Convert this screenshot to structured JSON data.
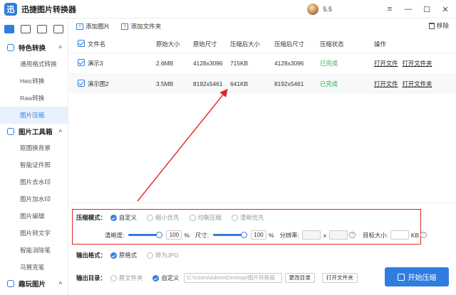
{
  "app": {
    "logo_glyph": "迅",
    "title": "迅捷图片转换器",
    "version": "5.5"
  },
  "window": {
    "menu_icon": "≡",
    "minimize_icon": "—",
    "maximize_icon": "☐",
    "close_icon": "✕"
  },
  "sidebar": {
    "sections": [
      {
        "title": "特色转换",
        "items": [
          "通用格式转换",
          "Heic转换",
          "Raw转换",
          "图片压缩"
        ]
      },
      {
        "title": "图片工具箱",
        "items": [
          "抠图换背景",
          "智能证件照",
          "图片去水印",
          "图片加水印",
          "图片编辑",
          "图片转文字",
          "智能消除笔",
          "马赛克笔"
        ]
      },
      {
        "title": "趣玩图片",
        "items": []
      }
    ],
    "active_item": "图片压缩"
  },
  "toolbar": {
    "add_image": "添加图片",
    "add_folder": "添加文件夹",
    "remove": "移除"
  },
  "table": {
    "headers": [
      "文件名",
      "原始大小",
      "原始尺寸",
      "压缩后大小",
      "压缩后尺寸",
      "压缩状态",
      "操作"
    ],
    "rows": [
      {
        "name": "演示3",
        "orig_size": "2.6MB",
        "orig_dim": "4128x3096",
        "new_size": "715KB",
        "new_dim": "4128x3096",
        "status": "已完成",
        "op1": "打开文件",
        "op2": "打开文件夹"
      },
      {
        "name": "演示图2",
        "orig_size": "3.5MB",
        "orig_dim": "8192x5461",
        "new_size": "641KB",
        "new_dim": "8192x5461",
        "status": "已完成",
        "op1": "打开文件",
        "op2": "打开文件夹"
      }
    ]
  },
  "compress": {
    "label": "压缩模式：",
    "modes": [
      "自定义",
      "缩小优先",
      "均衡压缩",
      "清晰优先"
    ],
    "selected": "自定义",
    "clarity_label": "清晰度:",
    "clarity_value": "100",
    "clarity_pct": 100,
    "size_label": "尺寸:",
    "size_value": "100",
    "size_pct": 100,
    "percent_unit": "%",
    "resolution_label": "分辨率:",
    "x_sep": "x",
    "target_label": "目标大小:",
    "kb_unit": "KB",
    "help_glyph": "?"
  },
  "output_format": {
    "label": "输出格式：",
    "options": [
      "原格式",
      "转为JPG"
    ],
    "selected": "原格式"
  },
  "output_dir": {
    "label": "输出目录：",
    "options": [
      "原文件夹",
      "自定义"
    ],
    "selected": "自定义",
    "path": "C:\\Users\\Admin\\Desktop\\图片转换器",
    "change_button": "更改目录",
    "open_button": "打开文件夹"
  },
  "start_button": "开始压缩",
  "colors": {
    "accent": "#2f7de1",
    "highlight_box": "#e02424",
    "status_done": "#32b05d"
  }
}
